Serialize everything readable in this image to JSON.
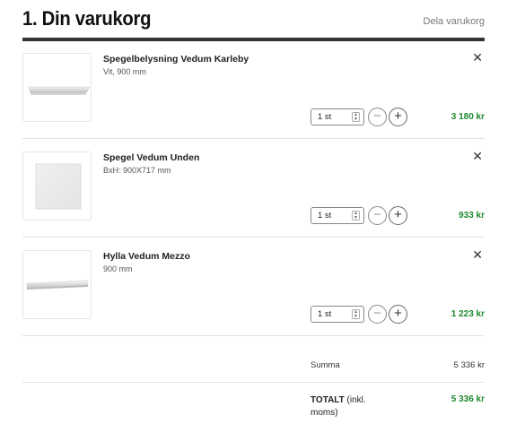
{
  "header": {
    "title": "1. Din varukorg",
    "share_label": "Dela varukorg"
  },
  "items": [
    {
      "name": "Spegelbelysning Vedum Karleby",
      "desc": "Vit, 900 mm",
      "qty": "1 st",
      "price": "3 180 kr",
      "thumb_icon": "light-bar-product-image"
    },
    {
      "name": "Spegel Vedum Unden",
      "desc": "BxH: 900X717 mm",
      "qty": "1 st",
      "price": "933 kr",
      "thumb_icon": "mirror-product-image"
    },
    {
      "name": "Hylla Vedum Mezzo",
      "desc": "900 mm",
      "qty": "1 st",
      "price": "1 223 kr",
      "thumb_icon": "shelf-product-image"
    }
  ],
  "controls": {
    "remove_glyph": "✕",
    "minus_glyph": "−",
    "plus_glyph": "+"
  },
  "summary": {
    "summa_label": "Summa",
    "summa_value": "5 336 kr",
    "total_label_bold": "TOTALT",
    "total_label_rest": " (inkl. moms)",
    "total_value": "5 336 kr"
  },
  "colors": {
    "price_green": "#1e8a2d",
    "header_rule": "#333333"
  }
}
